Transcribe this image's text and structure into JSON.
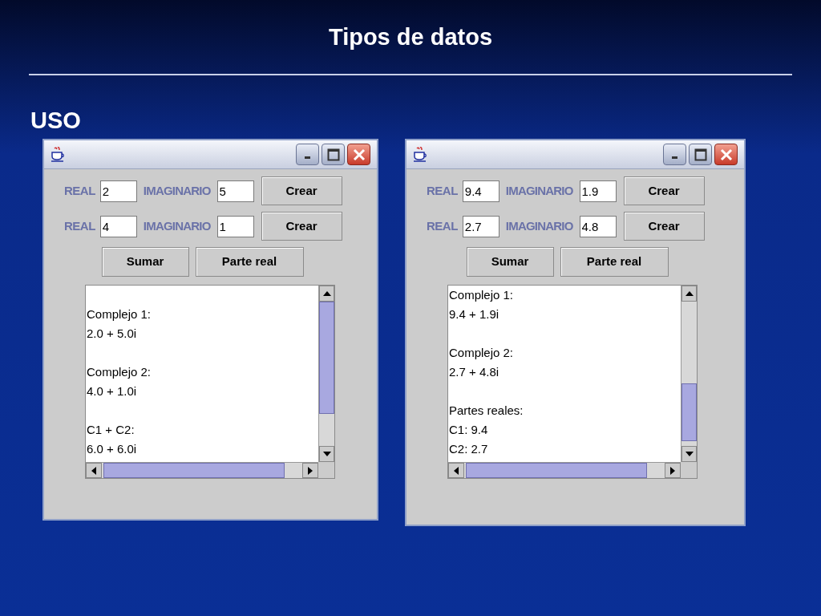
{
  "slide": {
    "title": "Tipos de datos",
    "heading": "USO"
  },
  "windows": [
    {
      "rows": [
        {
          "real_label": "REAL",
          "real_value": "2",
          "imag_label": "IMAGINARIO",
          "imag_value": "5",
          "button": "Crear"
        },
        {
          "real_label": "REAL",
          "real_value": "4",
          "imag_label": "IMAGINARIO",
          "imag_value": "1",
          "button": "Crear"
        }
      ],
      "buttons": [
        "Sumar",
        "Parte real"
      ],
      "output": {
        "blank_first_line": true,
        "blocks": [
          [
            "Complejo 1:",
            "2.0 + 5.0i"
          ],
          [
            "Complejo 2:",
            "4.0 + 1.0i"
          ],
          [
            "C1 + C2:",
            "6.0 + 6.0i"
          ]
        ]
      }
    },
    {
      "rows": [
        {
          "real_label": "REAL",
          "real_value": "9.4",
          "imag_label": "IMAGINARIO",
          "imag_value": "1.9",
          "button": "Crear"
        },
        {
          "real_label": "REAL",
          "real_value": "2.7",
          "imag_label": "IMAGINARIO",
          "imag_value": "4.8",
          "button": "Crear"
        }
      ],
      "buttons": [
        "Sumar",
        "Parte real"
      ],
      "output": {
        "blank_first_line": false,
        "blocks": [
          [
            "Complejo 1:",
            "9.4 + 1.9i"
          ],
          [
            "Complejo 2:",
            "2.7 + 4.8i"
          ],
          [
            "Partes reales:",
            "C1: 9.4",
            "C2: 2.7"
          ]
        ]
      }
    }
  ]
}
